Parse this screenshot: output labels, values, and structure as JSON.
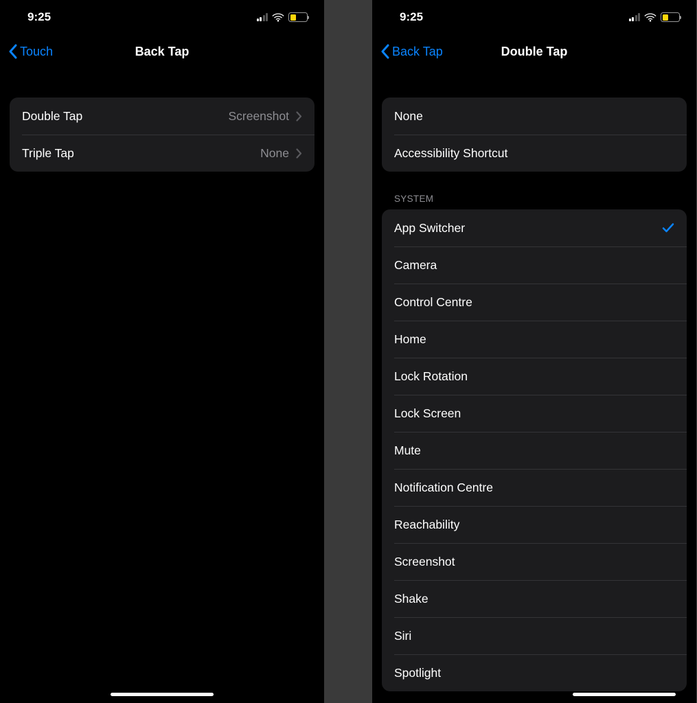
{
  "statusBar": {
    "time": "9:25"
  },
  "left": {
    "back": "Touch",
    "title": "Back Tap",
    "rows": [
      {
        "label": "Double Tap",
        "value": "Screenshot"
      },
      {
        "label": "Triple Tap",
        "value": "None"
      }
    ]
  },
  "right": {
    "back": "Back Tap",
    "title": "Double Tap",
    "topGroup": [
      {
        "label": "None",
        "checked": false
      },
      {
        "label": "Accessibility Shortcut",
        "checked": false
      }
    ],
    "systemHeader": "System",
    "systemGroup": [
      {
        "label": "App Switcher",
        "checked": true
      },
      {
        "label": "Camera",
        "checked": false
      },
      {
        "label": "Control Centre",
        "checked": false
      },
      {
        "label": "Home",
        "checked": false
      },
      {
        "label": "Lock Rotation",
        "checked": false
      },
      {
        "label": "Lock Screen",
        "checked": false
      },
      {
        "label": "Mute",
        "checked": false
      },
      {
        "label": "Notification Centre",
        "checked": false
      },
      {
        "label": "Reachability",
        "checked": false
      },
      {
        "label": "Screenshot",
        "checked": false
      },
      {
        "label": "Shake",
        "checked": false
      },
      {
        "label": "Siri",
        "checked": false
      },
      {
        "label": "Spotlight",
        "checked": false
      }
    ]
  }
}
